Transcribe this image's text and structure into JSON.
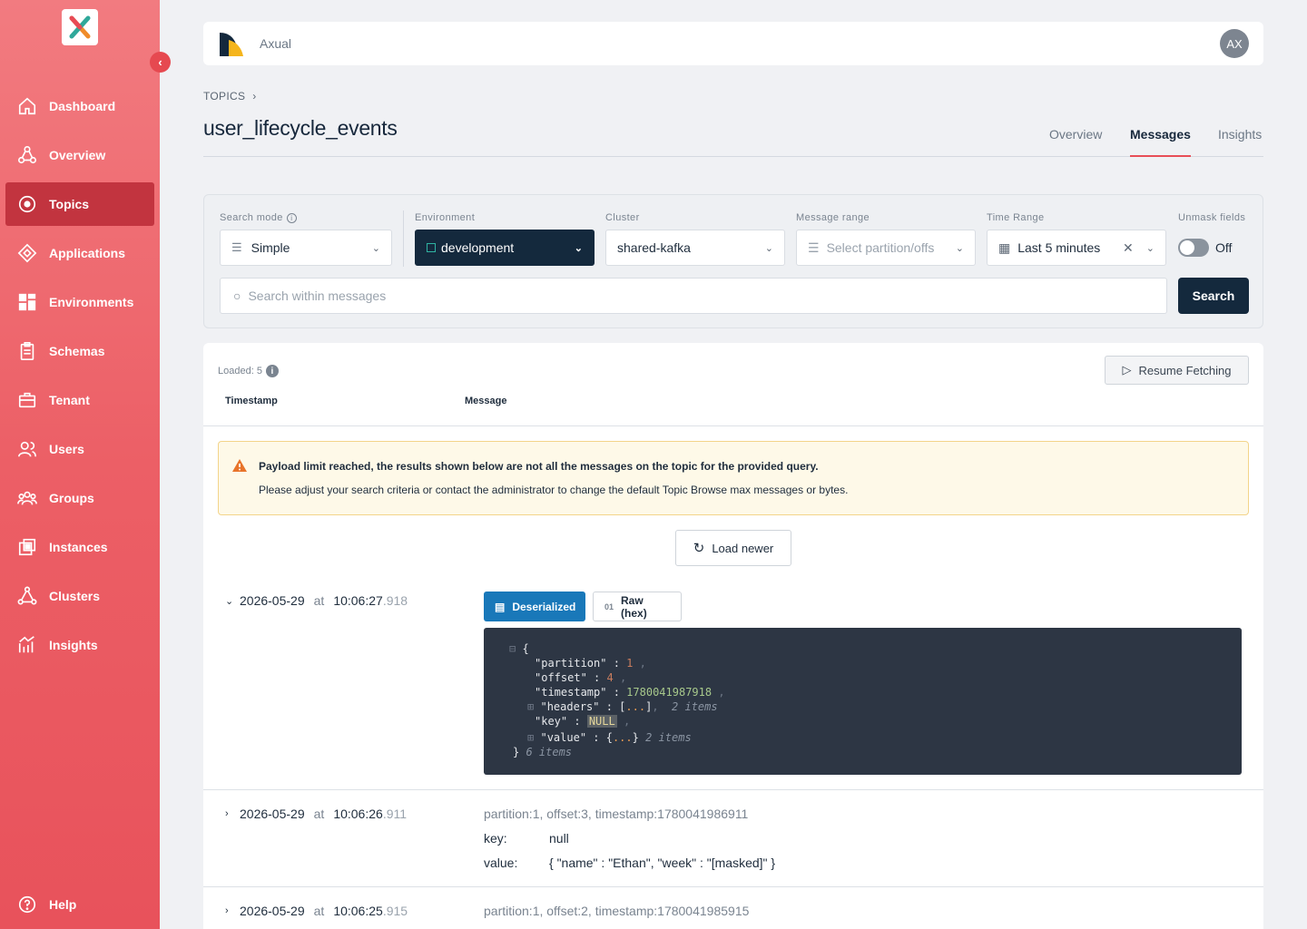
{
  "sidebar": {
    "items": [
      {
        "label": "Dashboard",
        "icon": "home-icon"
      },
      {
        "label": "Overview",
        "icon": "overview-icon"
      },
      {
        "label": "Topics",
        "icon": "topics-icon",
        "active": true
      },
      {
        "label": "Applications",
        "icon": "applications-icon"
      },
      {
        "label": "Environments",
        "icon": "environments-icon"
      },
      {
        "label": "Schemas",
        "icon": "schemas-icon"
      },
      {
        "label": "Tenant",
        "icon": "tenant-icon"
      },
      {
        "label": "Users",
        "icon": "users-icon"
      },
      {
        "label": "Groups",
        "icon": "groups-icon"
      },
      {
        "label": "Instances",
        "icon": "instances-icon"
      },
      {
        "label": "Clusters",
        "icon": "clusters-icon"
      },
      {
        "label": "Insights",
        "icon": "insights-icon"
      }
    ],
    "help_label": "Help"
  },
  "header": {
    "org_name": "Axual",
    "avatar_initials": "AX"
  },
  "breadcrumb": {
    "root": "TOPICS"
  },
  "page": {
    "title": "user_lifecycle_events"
  },
  "tabs": [
    "Overview",
    "Messages",
    "Insights"
  ],
  "filters": {
    "search_mode": {
      "label": "Search mode",
      "value": "Simple"
    },
    "environment": {
      "label": "Environment",
      "value": "development"
    },
    "cluster": {
      "label": "Cluster",
      "value": "shared-kafka"
    },
    "message_range": {
      "label": "Message range",
      "placeholder": "Select partition/offs"
    },
    "time_range": {
      "label": "Time Range",
      "value": "Last 5 minutes"
    },
    "unmask": {
      "label": "Unmask fields",
      "state": "Off"
    },
    "search_placeholder": "Search within messages",
    "search_button": "Search"
  },
  "results": {
    "loaded": "Loaded: 5",
    "resume_button": "Resume Fetching",
    "col_timestamp": "Timestamp",
    "col_message": "Message",
    "warning_title": "Payload limit reached, the results shown below are not all the messages on the topic for the provided query.",
    "warning_text": "Please adjust your search criteria or contact the administrator to change the default Topic Browse max messages or bytes.",
    "load_newer": "Load newer",
    "at": "at",
    "deserialized_button": "Deserialized",
    "raw_button": "Raw (hex)",
    "messages": [
      {
        "date": "2026-05-29",
        "time": "10:06:27",
        "ms": ".918",
        "expanded": true
      },
      {
        "date": "2026-05-29",
        "time": "10:06:26",
        "ms": ".911",
        "meta": "partition:1, offset:3, timestamp:1780041986911",
        "key_label": "key:",
        "key": "null",
        "value_label": "value:",
        "value": "{ \"name\" : \"Ethan\", \"week\" : \"[masked]\" }"
      },
      {
        "date": "2026-05-29",
        "time": "10:06:25",
        "ms": ".915",
        "meta": "partition:1, offset:2, timestamp:1780041985915"
      }
    ],
    "json": {
      "partition_key": "\"partition\"",
      "partition": "1",
      "offset_key": "\"offset\"",
      "offset": "4",
      "timestamp_key": "\"timestamp\"",
      "timestamp": "1780041987918",
      "headers_key": "\"headers\"",
      "headers_count": "2 items",
      "key_key": "\"key\"",
      "key": "NULL",
      "value_key": "\"value\"",
      "value_count": "2 items",
      "root_count": "6 items"
    }
  },
  "colors": {
    "sidebar": "#ec5f66",
    "active_nav": "#c2343f",
    "primary_dark": "#14293d",
    "accent_blue": "#1978b9"
  }
}
